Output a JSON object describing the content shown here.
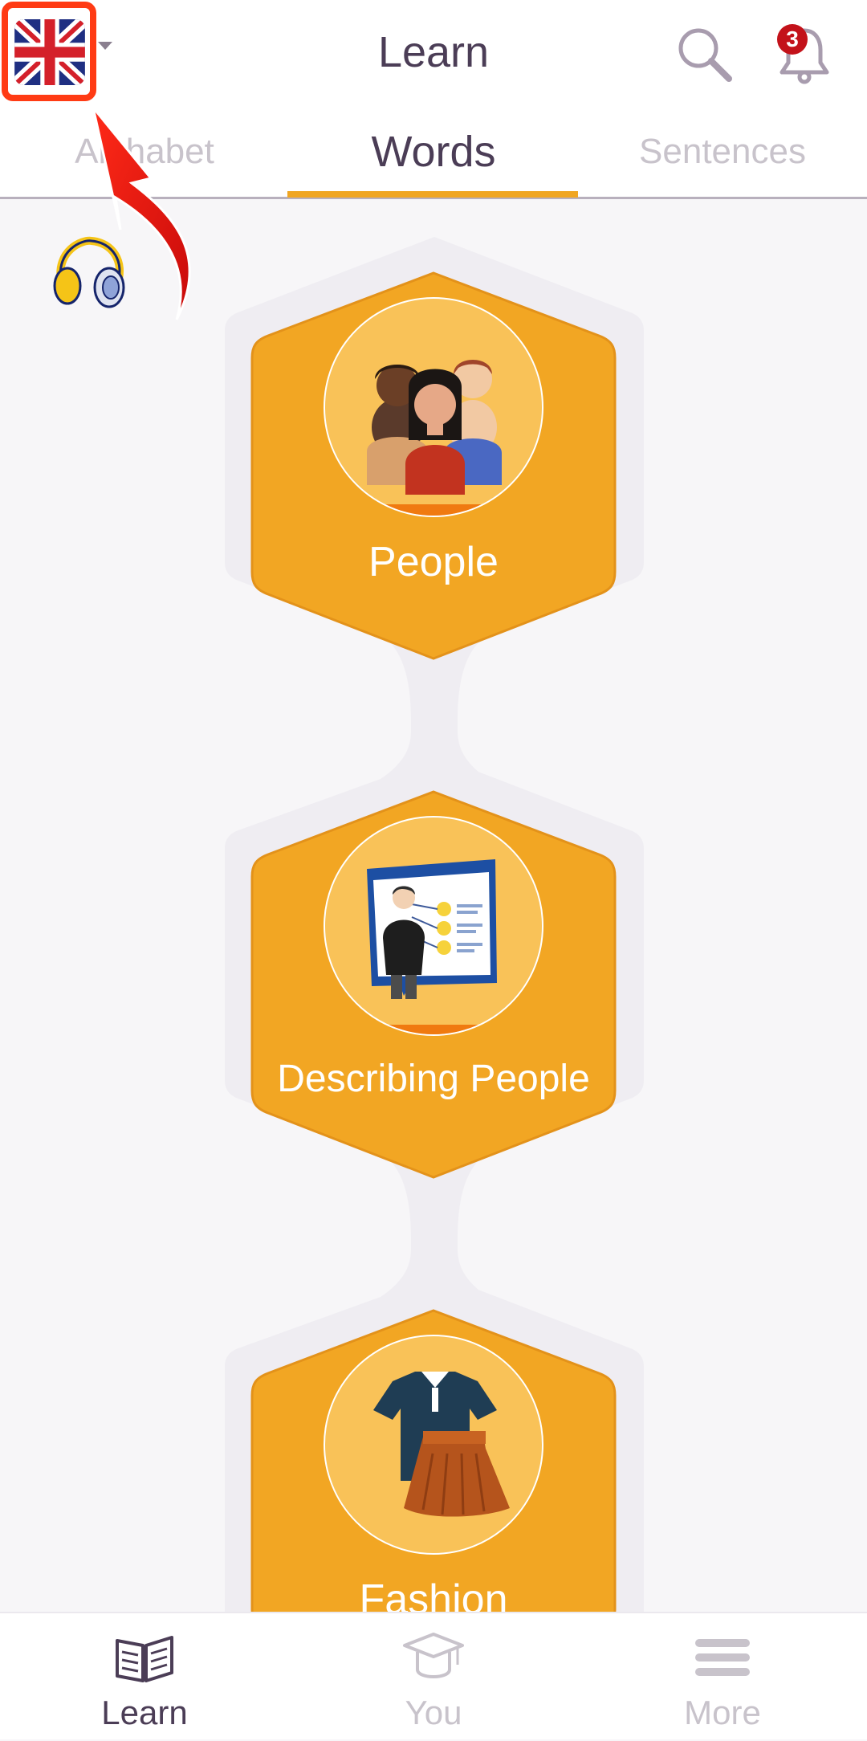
{
  "header": {
    "title": "Learn",
    "notification_count": "3"
  },
  "tabs": [
    {
      "label": "Alphabet"
    },
    {
      "label": "Words"
    },
    {
      "label": "Sentences"
    }
  ],
  "lessons": [
    {
      "label": "People",
      "icon": "people-group-icon"
    },
    {
      "label": "Describing People",
      "icon": "presentation-board-icon"
    },
    {
      "label": "Fashion",
      "icon": "clothing-icon"
    }
  ],
  "bottom_nav": [
    {
      "label": "Learn",
      "icon": "open-book-icon"
    },
    {
      "label": "You",
      "icon": "graduation-cap-icon"
    },
    {
      "label": "More",
      "icon": "menu-icon"
    }
  ],
  "colors": {
    "accent": "#f0a623",
    "card": "#f2a623",
    "circle": "#f9c258",
    "title": "#4b3d56",
    "highlight": "#ff3b14"
  }
}
